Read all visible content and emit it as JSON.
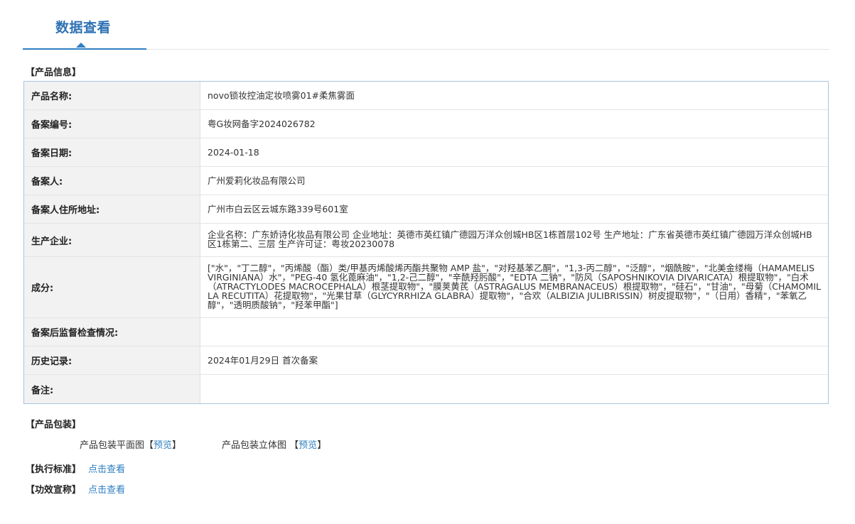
{
  "tab": {
    "title": "数据查看"
  },
  "product_info": {
    "section_label": "【产品信息】",
    "rows": [
      {
        "label": "产品名称:",
        "value": "novo锁妆控油定妆喷雾01#柔焦雾面"
      },
      {
        "label": "备案编号:",
        "value": "粤G妆网备字2024026782"
      },
      {
        "label": "备案日期:",
        "value": "2024-01-18"
      },
      {
        "label": "备案人:",
        "value": "广州爱莉化妆品有限公司"
      },
      {
        "label": "备案人住所地址:",
        "value": "广州市白云区云城东路339号601室"
      },
      {
        "label": "生产企业:",
        "value": "企业名称：广东娇诗化妆品有限公司 企业地址：英德市英红镇广德园万洋众创城HB区1栋首层102号 生产地址：广东省英德市英红镇广德园万洋众创城HB区1栋第二、三层 生产许可证：粤妆20230078"
      },
      {
        "label": "成分:",
        "value": "[\"水\"，\"丁二醇\"，\"丙烯酸（酯）类/甲基丙烯酸烯丙酯共聚物 AMP 盐\"，\"对羟基苯乙酮\"，\"1,3-丙二醇\"，\"泛醇\"，\"烟酰胺\"，\"北美金缕梅（HAMAMELIS VIRGINIANA）水\"，\"PEG-40 氢化蓖麻油\"，\"1,2-己二醇\"，\"辛酰羟肟酸\"，\"EDTA 二钠\"，\"防风（SAPOSHNIKOVIA DIVARICATA）根提取物\"，\"白术（ATRACTYLODES MACROCEPHALA）根茎提取物\"，\"膜荚黄芪（ASTRAGALUS MEMBRANACEUS）根提取物\"，\"硅石\"，\"甘油\"，\"母菊（CHAMOMILLA RECUTITA）花提取物\"，\"光果甘草（GLYCYRRHIZA GLABRA）提取物\"，\"合欢（ALBIZIA JULIBRISSIN）树皮提取物\"，\"（日用）香精\"，\"苯氧乙醇\"，\"透明质酸钠\"，\"羟苯甲酯\"]"
      },
      {
        "label": "备案后监督检查情况:",
        "value": ""
      },
      {
        "label": "历史记录:",
        "value": "2024年01月29日 首次备案"
      },
      {
        "label": "备注:",
        "value": ""
      }
    ]
  },
  "packaging": {
    "section_label": "【产品包装】",
    "flat_label": "产品包装平面图",
    "flat_open": "【",
    "flat_link": "预览",
    "flat_close": "】",
    "stereo_label": "产品包装立体图",
    "stereo_open": "【",
    "stereo_link": "预览",
    "stereo_close": "】"
  },
  "standard": {
    "section_label": "【执行标准】",
    "link": "点击查看"
  },
  "efficacy": {
    "section_label": "【功效宣称】",
    "link": "点击查看"
  },
  "colors": {
    "accent": "#2f7fc1",
    "title_blue": "#2f72b4",
    "table_border": "#a9c4e0",
    "label_bg": "#f2f2f2"
  }
}
